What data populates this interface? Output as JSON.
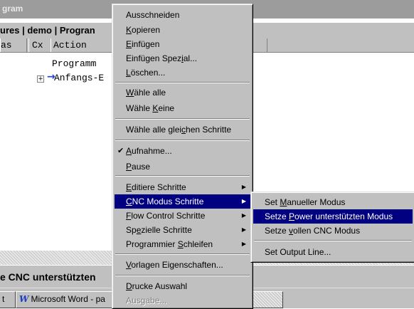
{
  "window": {
    "title_fragment": "gram",
    "tabs_fragment": "ures | demo | Progran",
    "columns": [
      "as",
      "Cx",
      "Action"
    ],
    "tree": [
      {
        "label": "Programm",
        "has_expander": false,
        "has_arrow": false
      },
      {
        "label": "Anfangs-E",
        "has_expander": true,
        "expander_symbol": "+",
        "has_arrow": true,
        "arrow_symbol": "→"
      }
    ],
    "status_fragment": "e CNC unterstützten"
  },
  "taskbar": {
    "items": [
      {
        "label": "t"
      },
      {
        "icon": "word-icon",
        "icon_glyph": "W",
        "label": "Microsoft Word - pa"
      }
    ]
  },
  "context_menu": {
    "items": [
      {
        "pre": "Ausschneiden",
        "u": "",
        "post": ""
      },
      {
        "pre": "",
        "u": "K",
        "post": "opieren"
      },
      {
        "pre": "",
        "u": "E",
        "post": "infügen"
      },
      {
        "pre": "Einfügen Spez",
        "u": "i",
        "post": "al..."
      },
      {
        "pre": "",
        "u": "L",
        "post": "öschen..."
      },
      {
        "pre": "",
        "u": "W",
        "post": "ähle alle"
      },
      {
        "pre": "Wähle ",
        "u": "K",
        "post": "eine"
      },
      {
        "pre": "Wähle alle glei",
        "u": "c",
        "post": "hen Schritte"
      },
      {
        "pre": "",
        "u": "A",
        "post": "ufnahme...",
        "checked": true,
        "check_glyph": "✔"
      },
      {
        "pre": "",
        "u": "P",
        "post": "ause"
      },
      {
        "pre": "",
        "u": "E",
        "post": "ditiere Schritte",
        "submenu": true
      },
      {
        "pre": "",
        "u": "C",
        "post": "NC Modus Schritte",
        "submenu": true,
        "selected": true
      },
      {
        "pre": "",
        "u": "F",
        "post": "low Control Schritte",
        "submenu": true
      },
      {
        "pre": "Sp",
        "u": "e",
        "post": "zielle Schritte",
        "submenu": true
      },
      {
        "pre": "Programmier ",
        "u": "S",
        "post": "chleifen",
        "submenu": true
      },
      {
        "pre": "",
        "u": "V",
        "post": "orlagen Eigenschaften..."
      },
      {
        "pre": "",
        "u": "D",
        "post": "rucke Auswahl"
      },
      {
        "pre": "Ausgabe...",
        "u": "",
        "post": "",
        "disabled": true
      }
    ],
    "submenu_arrow_glyph": "▶"
  },
  "cnc_submenu": {
    "items": [
      {
        "pre": "Set ",
        "u": "M",
        "post": "anueller Modus"
      },
      {
        "pre": "Setze ",
        "u": "P",
        "post": "ower unterstützten Modus",
        "selected": true
      },
      {
        "pre": "Setze ",
        "u": "v",
        "post": "ollen CNC Modus"
      },
      {
        "pre": "Set Output Line...",
        "u": "",
        "post": ""
      }
    ]
  }
}
